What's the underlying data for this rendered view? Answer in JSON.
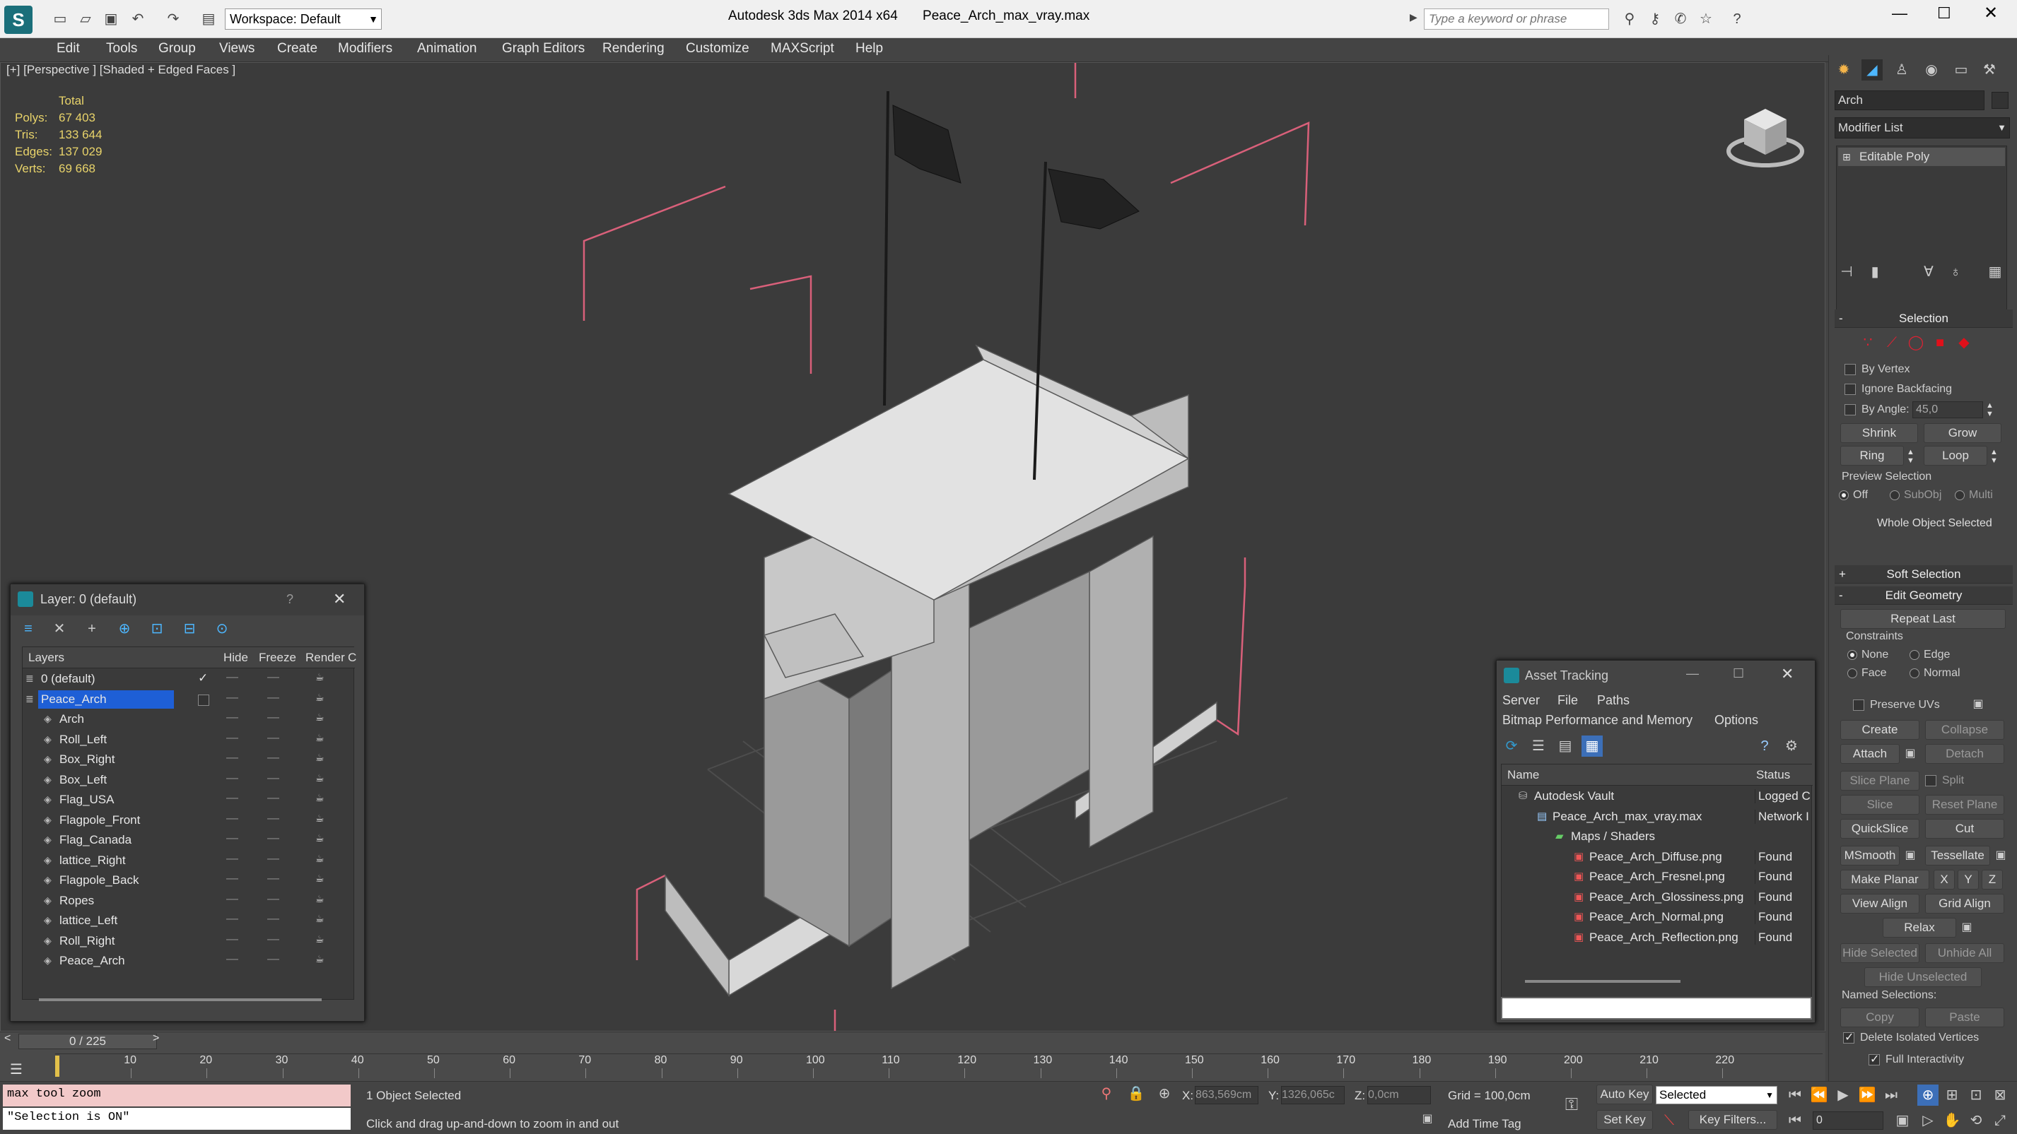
{
  "app": {
    "title": "Autodesk 3ds Max  2014 x64",
    "file": "Peace_Arch_max_vray.max",
    "workspace": "Workspace: Default",
    "search_placeholder": "Type a keyword or phrase"
  },
  "menu": [
    "Edit",
    "Tools",
    "Group",
    "Views",
    "Create",
    "Modifiers",
    "Animation",
    "Graph Editors",
    "Rendering",
    "Customize",
    "MAXScript",
    "Help"
  ],
  "viewport": {
    "label": "[+] [Perspective ] [Shaded + Edged Faces ]",
    "stats": {
      "header": "Total",
      "rows": [
        {
          "label": "Polys:",
          "value": "67 403"
        },
        {
          "label": "Tris:",
          "value": "133 644"
        },
        {
          "label": "Edges:",
          "value": "137 029"
        },
        {
          "label": "Verts:",
          "value": "69 668"
        }
      ]
    }
  },
  "layers": {
    "title": "Layer: 0 (default)",
    "help": "?",
    "columns": [
      "Layers",
      "Hide",
      "Freeze",
      "Render",
      "C"
    ],
    "rows": [
      {
        "name": "0 (default)",
        "kind": "layer"
      },
      {
        "name": "Peace_Arch",
        "kind": "layer",
        "selected": true
      },
      {
        "name": "Arch",
        "kind": "object"
      },
      {
        "name": "Roll_Left",
        "kind": "object"
      },
      {
        "name": "Box_Right",
        "kind": "object"
      },
      {
        "name": "Box_Left",
        "kind": "object"
      },
      {
        "name": "Flag_USA",
        "kind": "object"
      },
      {
        "name": "Flagpole_Front",
        "kind": "object"
      },
      {
        "name": "Flag_Canada",
        "kind": "object"
      },
      {
        "name": "lattice_Right",
        "kind": "object"
      },
      {
        "name": "Flagpole_Back",
        "kind": "object"
      },
      {
        "name": "Ropes",
        "kind": "object"
      },
      {
        "name": "lattice_Left",
        "kind": "object"
      },
      {
        "name": "Roll_Right",
        "kind": "object"
      },
      {
        "name": "Peace_Arch",
        "kind": "object"
      }
    ]
  },
  "assets": {
    "title": "Asset Tracking",
    "menu": [
      "Server",
      "File",
      "Paths"
    ],
    "menu2": [
      "Bitmap Performance and Memory",
      "Options"
    ],
    "columns": [
      "Name",
      "Status"
    ],
    "rows": [
      {
        "name": "Autodesk Vault",
        "status": "Logged C",
        "indent": 0
      },
      {
        "name": "Peace_Arch_max_vray.max",
        "status": "Network I",
        "indent": 1
      },
      {
        "name": "Maps / Shaders",
        "status": "",
        "indent": 2
      },
      {
        "name": "Peace_Arch_Diffuse.png",
        "status": "Found",
        "indent": 3
      },
      {
        "name": "Peace_Arch_Fresnel.png",
        "status": "Found",
        "indent": 3
      },
      {
        "name": "Peace_Arch_Glossiness.png",
        "status": "Found",
        "indent": 3
      },
      {
        "name": "Peace_Arch_Normal.png",
        "status": "Found",
        "indent": 3
      },
      {
        "name": "Peace_Arch_Reflection.png",
        "status": "Found",
        "indent": 3
      }
    ]
  },
  "command_panel": {
    "object_name": "Arch",
    "modifier_list": "Modifier List",
    "stack_item": "Editable Poly",
    "selection": {
      "title": "Selection",
      "by_vertex": "By Vertex",
      "ignore_backfacing": "Ignore Backfacing",
      "by_angle": "By Angle:",
      "angle_value": "45,0",
      "shrink": "Shrink",
      "grow": "Grow",
      "ring": "Ring",
      "loop": "Loop",
      "preview_title": "Preview Selection",
      "preview_options": [
        "Off",
        "SubObj",
        "Multi"
      ],
      "status": "Whole Object Selected"
    },
    "soft_selection": "Soft Selection",
    "edit_geometry": {
      "title": "Edit Geometry",
      "repeat_last": "Repeat Last",
      "constraints": "Constraints",
      "constraint_options": [
        "None",
        "Edge",
        "Face",
        "Normal"
      ],
      "preserve_uvs": "Preserve UVs",
      "create": "Create",
      "collapse": "Collapse",
      "attach": "Attach",
      "detach": "Detach",
      "slice_plane": "Slice Plane",
      "split": "Split",
      "slice": "Slice",
      "reset_plane": "Reset Plane",
      "quickslice": "QuickSlice",
      "cut": "Cut",
      "msmooth": "MSmooth",
      "tessellate": "Tessellate",
      "make_planar": "Make Planar",
      "x": "X",
      "y": "Y",
      "z": "Z",
      "view_align": "View Align",
      "grid_align": "Grid Align",
      "relax": "Relax",
      "hide_selected": "Hide Selected",
      "unhide_all": "Unhide All",
      "hide_unselected": "Hide Unselected",
      "named_selections": "Named Selections:",
      "copy": "Copy",
      "paste": "Paste",
      "delete_isolated": "Delete Isolated Vertices",
      "full_interactivity": "Full Interactivity"
    }
  },
  "timeline": {
    "frame": "0 / 225",
    "ticks": [
      "10",
      "20",
      "30",
      "40",
      "50",
      "60",
      "70",
      "80",
      "90",
      "100",
      "110",
      "120",
      "130",
      "140",
      "150",
      "160",
      "170",
      "180",
      "190",
      "200",
      "210",
      "220"
    ]
  },
  "status": {
    "script_line1": "max tool zoom",
    "script_line2": "\"Selection is ON\"",
    "selected": "1 Object Selected",
    "prompt": "Click and drag up-and-down to zoom in and out",
    "x_label": "X:",
    "x_value": "863,569cm",
    "y_label": "Y:",
    "y_value": "1326,065c",
    "z_label": "Z:",
    "z_value": "0,0cm",
    "grid": "Grid = 100,0cm",
    "add_time_tag": "Add Time Tag",
    "auto_key": "Auto Key",
    "set_key": "Set Key",
    "selected_dropdown": "Selected",
    "key_filters": "Key Filters...",
    "frame_field": "0"
  },
  "colors": {
    "selection_blue": "#1e5fd6",
    "stats_yellow": "#e8d36a",
    "script_pink": "#f2c9c9"
  }
}
